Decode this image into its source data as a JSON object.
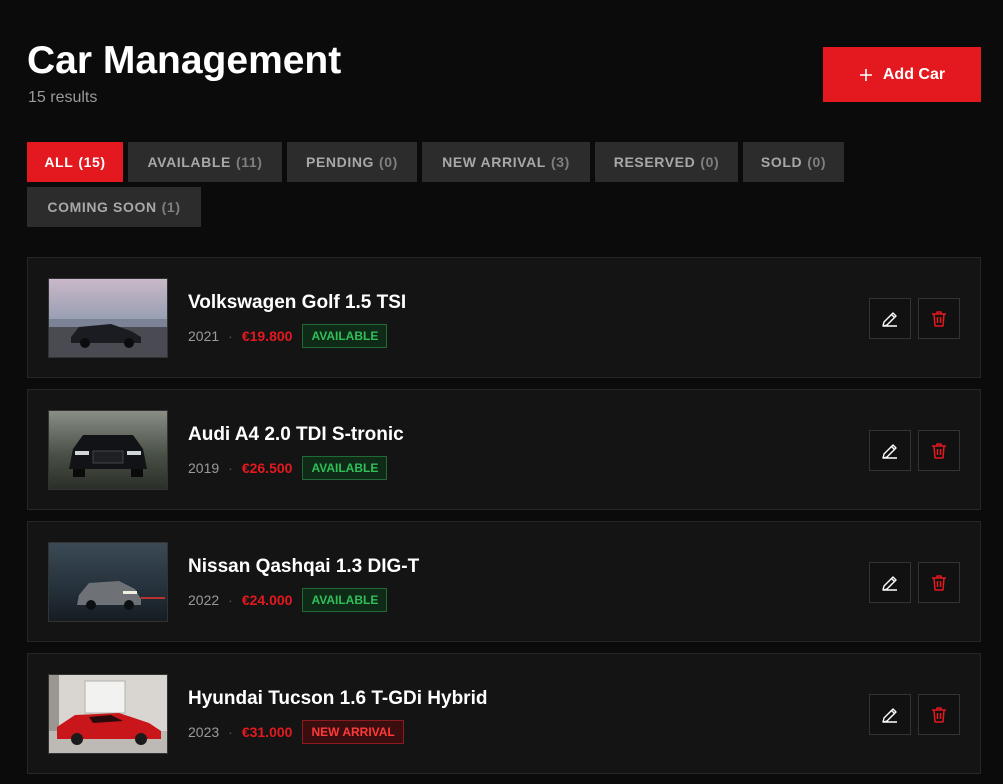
{
  "header": {
    "title": "Car Management",
    "results": "15 results",
    "add_label": "Add Car"
  },
  "filters": [
    {
      "label": "ALL",
      "count": "(15)",
      "active": true
    },
    {
      "label": "AVAILABLE",
      "count": "(11)",
      "active": false
    },
    {
      "label": "PENDING",
      "count": "(0)",
      "active": false
    },
    {
      "label": "NEW ARRIVAL",
      "count": "(3)",
      "active": false
    },
    {
      "label": "RESERVED",
      "count": "(0)",
      "active": false
    },
    {
      "label": "SOLD",
      "count": "(0)",
      "active": false
    },
    {
      "label": "COMING SOON",
      "count": "(1)",
      "active": false
    }
  ],
  "cars": [
    {
      "name": "Volkswagen Golf 1.5 TSI",
      "year": "2021",
      "separator": "·",
      "price": "€19.800",
      "status": "AVAILABLE"
    },
    {
      "name": "Audi A4 2.0 TDI S-tronic",
      "year": "2019",
      "separator": "·",
      "price": "€26.500",
      "status": "AVAILABLE"
    },
    {
      "name": "Nissan Qashqai 1.3 DIG-T",
      "year": "2022",
      "separator": "·",
      "price": "€24.000",
      "status": "AVAILABLE"
    },
    {
      "name": "Hyundai Tucson 1.6 T-GDi Hybrid",
      "year": "2023",
      "separator": "·",
      "price": "€31.000",
      "status": "NEW ARRIVAL"
    }
  ],
  "icons": {
    "add": "plus-icon",
    "edit": "pencil-icon",
    "delete": "trash-icon"
  },
  "colors": {
    "accent": "#e3191f",
    "available": "#2fbf5a",
    "new_arrival": "#ff3a3a",
    "background": "#0b0b0b",
    "card": "#141414"
  }
}
